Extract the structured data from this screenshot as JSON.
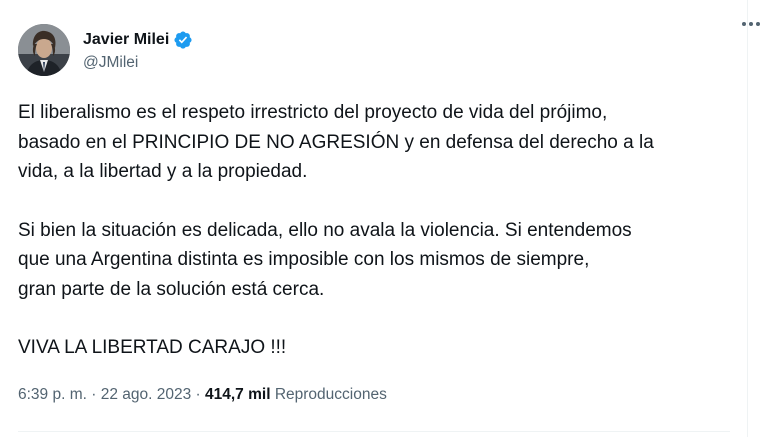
{
  "author": {
    "display_name": "Javier Milei",
    "handle": "@JMilei",
    "verified": true,
    "verified_color": "#1d9bf0"
  },
  "menu": {
    "icon": "more-horizontal-icon"
  },
  "tweet": {
    "paragraphs": [
      "El liberalismo es el respeto irrestricto del proyecto de vida del prójimo,\nbasado en el PRINCIPIO DE NO AGRESIÓN y en defensa del derecho a la\nvida, a la libertad y a la propiedad.",
      "Si bien la situación es delicada, ello no avala la violencia. Si entendemos\nque una Argentina distinta es imposible con los mismos de siempre,\ngran parte de la solución está cerca.",
      "VIVA LA LIBERTAD CARAJO !!!"
    ]
  },
  "meta": {
    "time": "6:39 p. m.",
    "separator": " · ",
    "date": "22 ago. 2023",
    "views_count": "414,7 mil",
    "views_label": "Reproducciones"
  }
}
